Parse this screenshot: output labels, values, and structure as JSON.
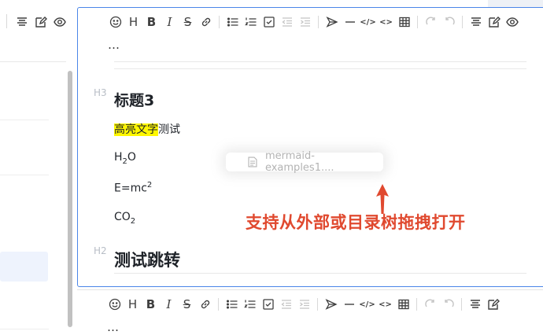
{
  "left_toolbar": {
    "icons": [
      "align-icon",
      "edit-icon",
      "preview-eye-icon"
    ]
  },
  "editor_top": {
    "more_label": "…",
    "gutter_h3": "H3",
    "gutter_h2": "H2",
    "heading3": "标题3",
    "highlight_text": "高亮文字",
    "highlight_suffix": "测试",
    "h2o_prefix": "H",
    "h2o_sub": "2",
    "h2o_suffix": "O",
    "emc_prefix": "E=mc",
    "emc_sup": "2",
    "co2_prefix": "CO",
    "co2_sub": "2",
    "heading2": "测试跳转"
  },
  "editor_bottom": {
    "more_label": "…"
  },
  "toolbar": {
    "bold_label": "B",
    "heading_label": "H",
    "italic_label": "I",
    "strike_label": "S",
    "code_label": "</>",
    "inline_code_label": "<>"
  },
  "drag": {
    "file_name": "mermaid-examples1...."
  },
  "annotation": {
    "text": "支持从外部或目录树拖拽打开",
    "color": "#e0492f"
  },
  "colors": {
    "accent_border": "#4a86e8",
    "highlight": "#fff700"
  }
}
